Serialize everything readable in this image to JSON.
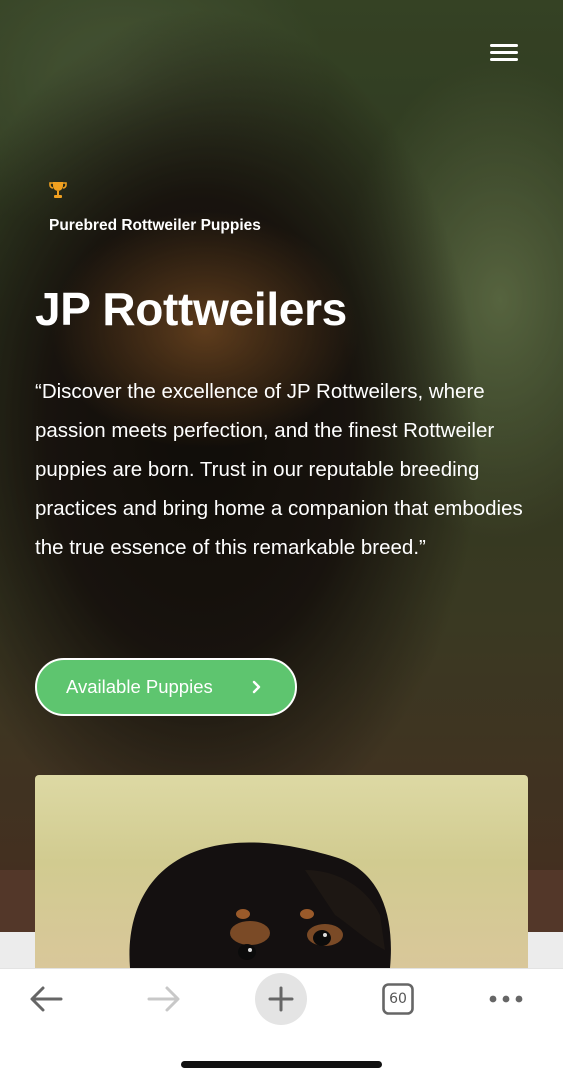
{
  "hero": {
    "eyebrow": "Purebred Rottweiler Puppies",
    "title": "JP Rottweilers",
    "description": "“Discover the excellence of JP Rottweilers, where passion meets perfection, and the finest Rottweiler puppies are born. Trust in our reputable breeding practices and bring home a companion that embodies the true essence of this remarkable breed.”",
    "cta_label": "Available Puppies",
    "icon": "trophy-icon"
  },
  "browser": {
    "tabs_count": "60"
  },
  "colors": {
    "accent": "#5ec56f",
    "trophy": "#f0a020",
    "text": "#ffffff"
  }
}
